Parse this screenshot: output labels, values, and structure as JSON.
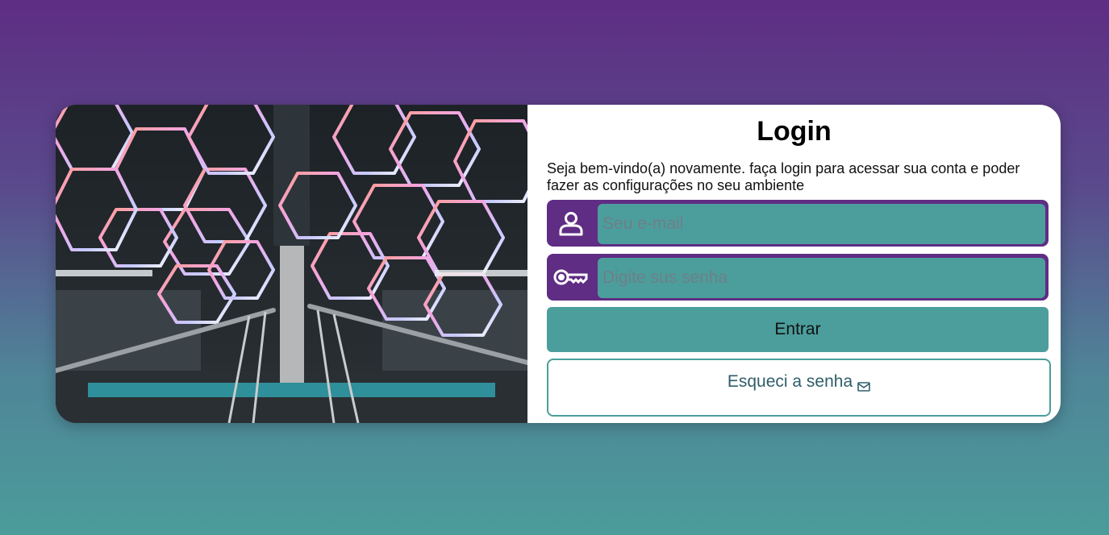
{
  "login": {
    "title": "Login",
    "subtitle": "Seja bem-vindo(a) novamente. faça login para acessar sua conta e poder fazer as configurações no seu ambiente",
    "email": {
      "placeholder": "Seu e-mail",
      "value": "",
      "icon": "user-icon"
    },
    "password": {
      "placeholder": "Digite sus senha",
      "value": "",
      "icon": "key-icon"
    },
    "submit_label": "Entrar",
    "forgot_label": "Esqueci a senha",
    "forgot_icon": "mail-icon"
  },
  "colors": {
    "primary_purple": "#5f2d84",
    "teal": "#4b9e9c",
    "card_bg": "#ffffff"
  }
}
